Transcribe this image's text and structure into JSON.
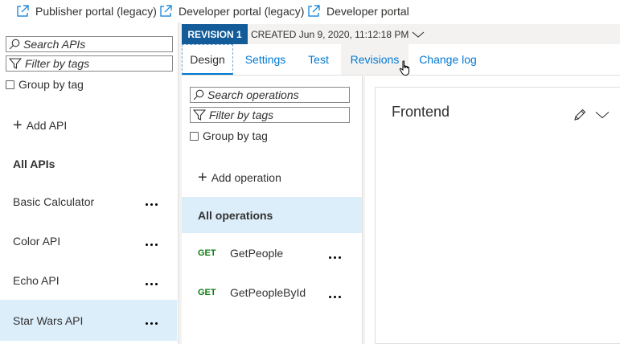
{
  "portal_links": [
    {
      "label": "Publisher portal (legacy)",
      "icon": "external-link-icon"
    },
    {
      "label": "Developer portal (legacy)",
      "icon": "external-link-icon"
    },
    {
      "label": "Developer portal",
      "icon": "external-link-icon"
    }
  ],
  "apis_panel": {
    "search_placeholder": "Search APIs",
    "filter_placeholder": "Filter by tags",
    "group_by_tag": "Group by tag",
    "add_api": "Add API",
    "all_apis": "All APIs",
    "items": [
      {
        "label": "Basic Calculator"
      },
      {
        "label": "Color API"
      },
      {
        "label": "Echo API"
      },
      {
        "label": "Star Wars API",
        "selected": true
      }
    ]
  },
  "revision": {
    "badge": "REVISION 1",
    "created": "CREATED Jun 9, 2020, 11:12:18 PM"
  },
  "tabs": [
    {
      "label": "Design",
      "active": true
    },
    {
      "label": "Settings"
    },
    {
      "label": "Test"
    },
    {
      "label": "Revisions",
      "hover": true
    },
    {
      "label": "Change log"
    }
  ],
  "operations_panel": {
    "search_placeholder": "Search operations",
    "filter_placeholder": "Filter by tags",
    "group_by_tag": "Group by tag",
    "add_operation": "Add operation",
    "all_operations": "All operations",
    "items": [
      {
        "method": "GET",
        "label": "GetPeople"
      },
      {
        "method": "GET",
        "label": "GetPeopleById"
      }
    ]
  },
  "frontend": {
    "title": "Frontend"
  },
  "colors": {
    "accent": "#0078d4",
    "revision_badge": "#135c99",
    "selected_bg": "#ddeefb",
    "get_method": "#107c10"
  }
}
